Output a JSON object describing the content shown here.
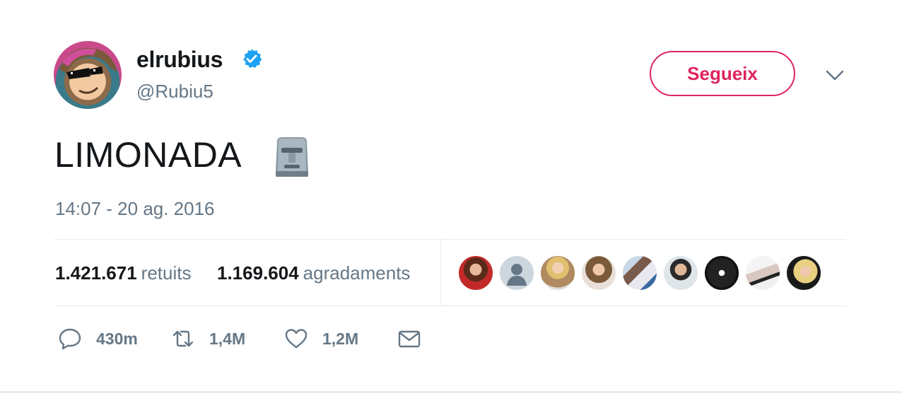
{
  "user": {
    "display_name": "elrubius",
    "handle": "@Rubiu5",
    "verified": true
  },
  "follow_button": {
    "label": "Segueix"
  },
  "tweet": {
    "text": "LIMONADA",
    "emoji": "moai",
    "timestamp": "14:07 - 20 ag. 2016"
  },
  "stats": {
    "retweets_count": "1.421.671",
    "retweets_label": "retuits",
    "likes_count": "1.169.604",
    "likes_label": "agradaments"
  },
  "likers_avatars_count": 9,
  "actions": {
    "reply_count": "430m",
    "retweet_count": "1,4M",
    "like_count": "1,2M"
  },
  "colors": {
    "follow_accent": "#e0245e",
    "verified_blue": "#1da1f2",
    "secondary_text": "#657786",
    "divider": "#e6ecf0"
  }
}
